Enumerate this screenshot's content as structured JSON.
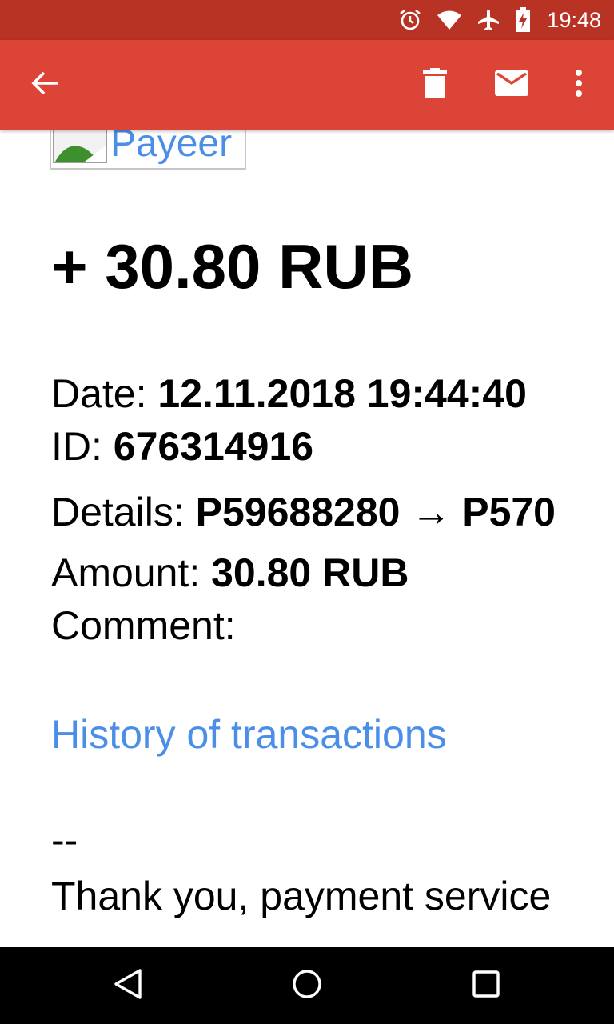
{
  "status_bar": {
    "time": "19:48",
    "icons": [
      "alarm-icon",
      "wifi-icon",
      "airplane-icon",
      "battery-charging-icon"
    ]
  },
  "toolbar": {
    "back_icon": "arrow-back-icon",
    "delete_icon": "trash-icon",
    "mail_icon": "mail-icon",
    "more_icon": "more-vert-icon",
    "color": "#db4437"
  },
  "email": {
    "logo_alt": "Payeer",
    "amount_heading": "+ 30.80 RUB",
    "date_label": "Date: ",
    "date_value": "12.11.2018 19:44:40",
    "id_label": "ID: ",
    "id_value": "676314916",
    "details_label": "Details: ",
    "details_value": "P59688280 → P570",
    "amount_label": "Amount: ",
    "amount_value": "30.80 RUB",
    "comment_label": "Comment:",
    "history_link": "History of transactions",
    "signature_dash": "--",
    "thanks": "Thank you, payment service"
  },
  "nav_bar": {
    "icons": [
      "nav-back-icon",
      "nav-home-icon",
      "nav-recents-icon"
    ]
  },
  "colors": {
    "status_bar": "#b93325",
    "link": "#4a8ee8"
  }
}
